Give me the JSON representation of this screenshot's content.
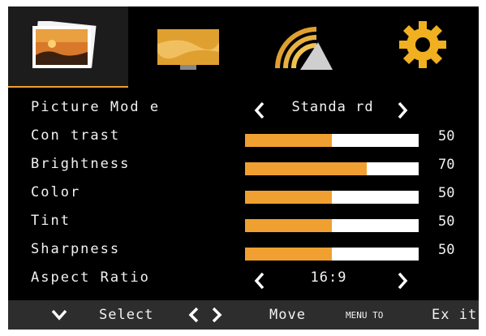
{
  "tabs": [
    {
      "name": "picture-tab",
      "icon": "picture-icon",
      "active": true
    },
    {
      "name": "screen-tab",
      "icon": "screen-icon",
      "active": false
    },
    {
      "name": "signal-tab",
      "icon": "signal-icon",
      "active": false
    },
    {
      "name": "settings-tab",
      "icon": "gear-icon",
      "active": false
    }
  ],
  "colors": {
    "accent": "#f0a030",
    "bar_bg": "#ffffff",
    "osd_bg": "#000000",
    "footer_bg": "#2d2d2d"
  },
  "menu": {
    "picture_mode": {
      "label": "Picture Mod e",
      "value": "Standa rd"
    },
    "contrast": {
      "label": "Con trast",
      "value": "50",
      "level": 0.5
    },
    "brightness": {
      "label": "Brightness",
      "value": "70",
      "level": 0.7
    },
    "color": {
      "label": "Color",
      "value": "50",
      "level": 0.5
    },
    "tint": {
      "label": "Tint",
      "value": "50",
      "level": 0.5
    },
    "sharpness": {
      "label": "Sharpness",
      "value": "50",
      "level": 0.5
    },
    "aspect_ratio": {
      "label": "Aspect Ratio",
      "value": "16:9"
    }
  },
  "footer": {
    "select_label": "Select",
    "move_label": "Move",
    "menu_to_label": "MENU TO",
    "exit_label": "Ex it"
  }
}
